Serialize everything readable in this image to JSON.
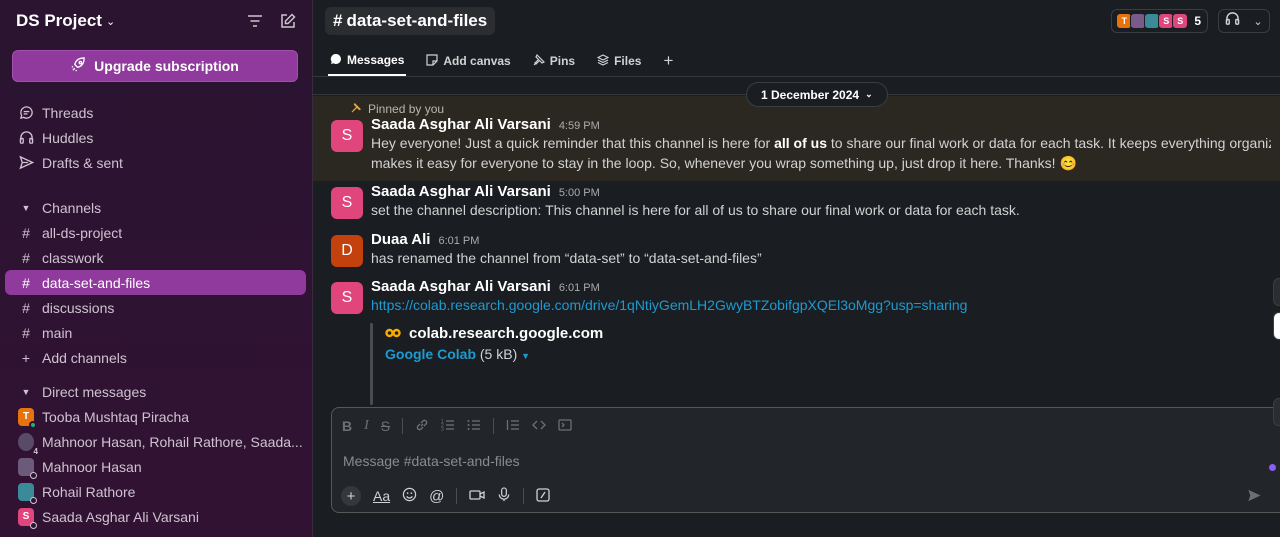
{
  "workspace": {
    "name": "DS Project",
    "upgrade_label": "Upgrade subscription"
  },
  "nav": [
    {
      "label": "Threads",
      "icon": "threads-icon"
    },
    {
      "label": "Huddles",
      "icon": "headphones-icon"
    },
    {
      "label": "Drafts & sent",
      "icon": "send-icon"
    }
  ],
  "channels": {
    "heading": "Channels",
    "items": [
      {
        "label": "all-ds-project",
        "active": false
      },
      {
        "label": "classwork",
        "active": false
      },
      {
        "label": "data-set-and-files",
        "active": true
      },
      {
        "label": "discussions",
        "active": false
      },
      {
        "label": "main",
        "active": false
      }
    ],
    "add_label": "Add channels"
  },
  "dms": {
    "heading": "Direct messages",
    "items": [
      {
        "label": "Tooba Mushtaq Piracha",
        "initial": "T",
        "color": "#e8730c"
      },
      {
        "label": "Mahnoor Hasan, Rohail Rathore, Saada...",
        "initial": "",
        "color": "#5a4a6a",
        "count": "4"
      },
      {
        "label": "Mahnoor Hasan",
        "initial": "",
        "color": "#6b5a7a"
      },
      {
        "label": "Rohail Rathore",
        "initial": "",
        "color": "#3a8a9a"
      },
      {
        "label": "Saada Asghar Ali Varsani",
        "initial": "S",
        "color": "#e0457b"
      }
    ]
  },
  "channel": {
    "name": "data-set-and-files",
    "member_count": "5",
    "member_avatars": [
      {
        "initial": "T",
        "color": "#e8730c"
      },
      {
        "initial": "",
        "color": "#7a5a8a"
      },
      {
        "initial": "",
        "color": "#3a8a9a"
      },
      {
        "initial": "S",
        "color": "#e0457b"
      },
      {
        "initial": "S",
        "color": "#e0457b"
      }
    ]
  },
  "tabs": [
    {
      "label": "Messages",
      "active": true
    },
    {
      "label": "Add canvas",
      "active": false
    },
    {
      "label": "Pins",
      "active": false
    },
    {
      "label": "Files",
      "active": false
    }
  ],
  "date_divider": "1 December 2024",
  "pinned_label": "Pinned by you",
  "messages": [
    {
      "author": "Saada Asghar Ali Varsani",
      "time": "4:59 PM",
      "initial": "S",
      "color": "#e0457b",
      "line1_pre": "Hey everyone! Just a quick reminder that this channel is here for ",
      "line1_bold": "all of us",
      "line1_post": " to share our final work or data for each task. It keeps everything organized and",
      "line2": "makes it easy for everyone to stay in the loop. So, whenever you wrap something up, just drop it here. Thanks! 😊"
    },
    {
      "author": "Saada Asghar Ali Varsani",
      "time": "5:00 PM",
      "initial": "S",
      "color": "#e0457b",
      "text": "set the channel description: This channel is here for all of us to share our final work or data for each task."
    },
    {
      "author": "Duaa Ali",
      "time": "6:01 PM",
      "initial": "D",
      "color": "#c2410c",
      "text": "has renamed the channel from “data-set” to “data-set-and-files”"
    },
    {
      "author": "Saada Asghar Ali Varsani",
      "time": "6:01 PM",
      "initial": "S",
      "color": "#e0457b",
      "link": "https://colab.research.google.com/drive/1qNtiyGemLH2GwyBTZobifgpXQEl3oMgg?usp=sharing",
      "unfurl_site": "colab.research.google.com",
      "unfurl_file": "Google Colab",
      "unfurl_size": "(5 kB)"
    }
  ],
  "composer": {
    "placeholder": "Message #data-set-and-files"
  }
}
